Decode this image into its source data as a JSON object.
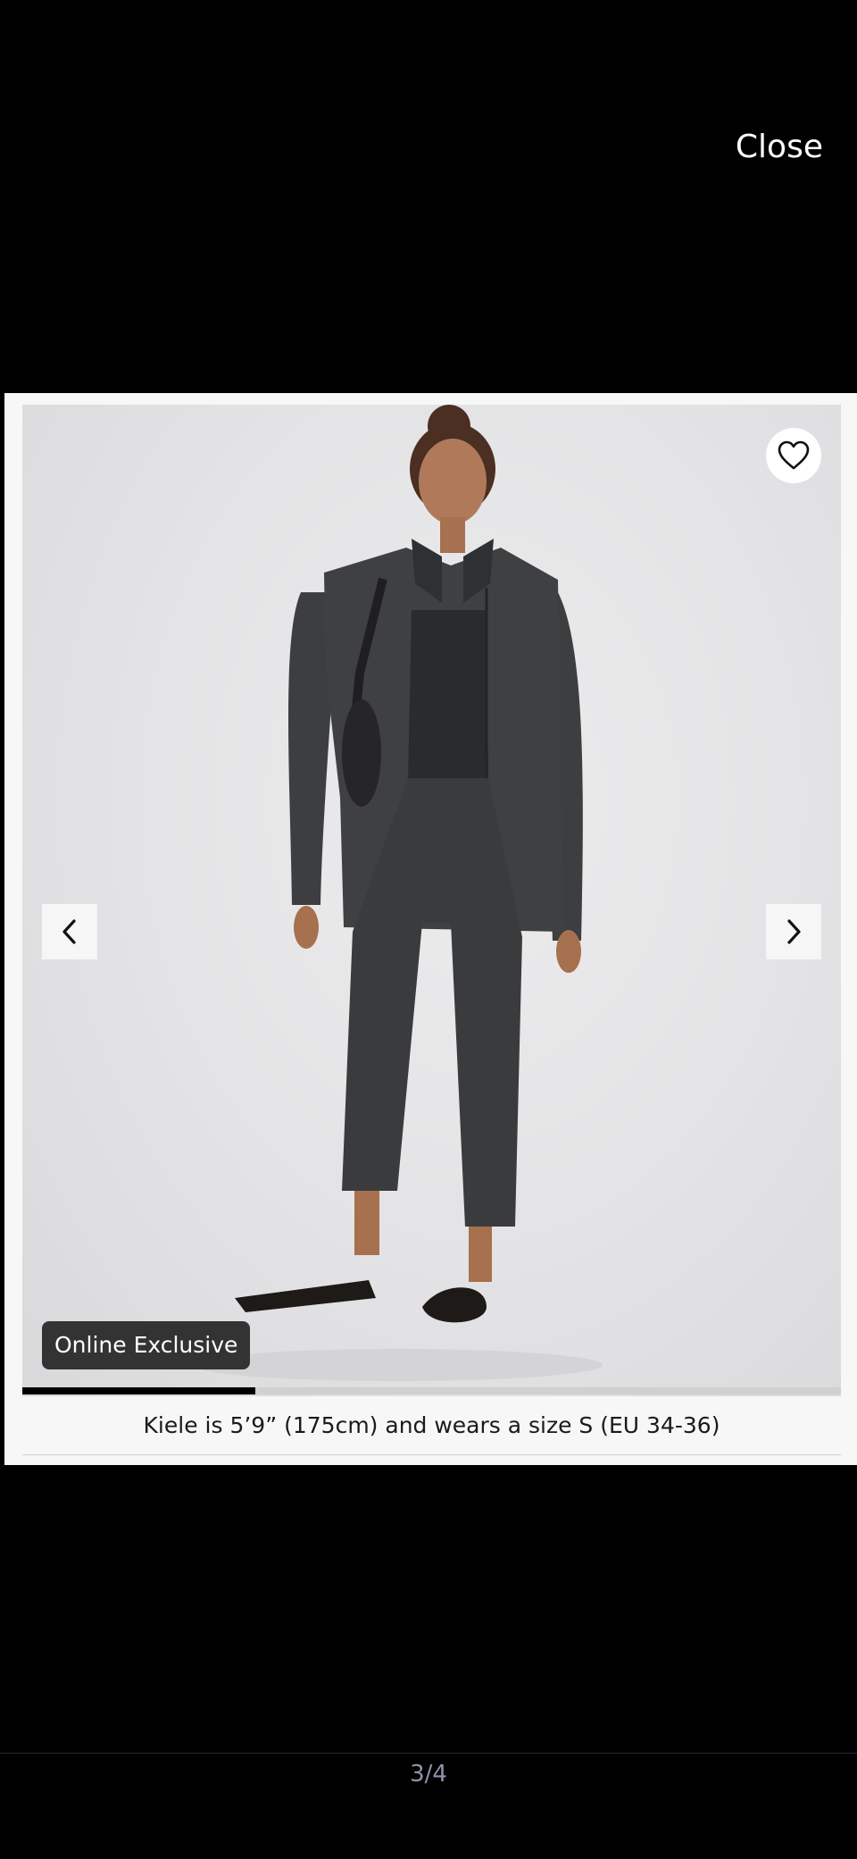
{
  "viewer": {
    "close_label": "Close",
    "counter": "3/4",
    "current_index": 3,
    "total": 4
  },
  "slide": {
    "badge": "Online Exclusive",
    "caption": "Kiele is 5’9” (175cm) and wears a size S (EU 34-36)",
    "progress": 0.285
  },
  "icons": {
    "favorite": "heart-outline-icon",
    "previous": "chevron-left-icon",
    "next": "chevron-right-icon"
  },
  "colors": {
    "background": "#000000",
    "card": "#f7f7f7",
    "badge_bg": "#333333",
    "progress_fill": "#000000",
    "progress_track": "#d0d0d0",
    "counter_text": "#8f93a8"
  }
}
